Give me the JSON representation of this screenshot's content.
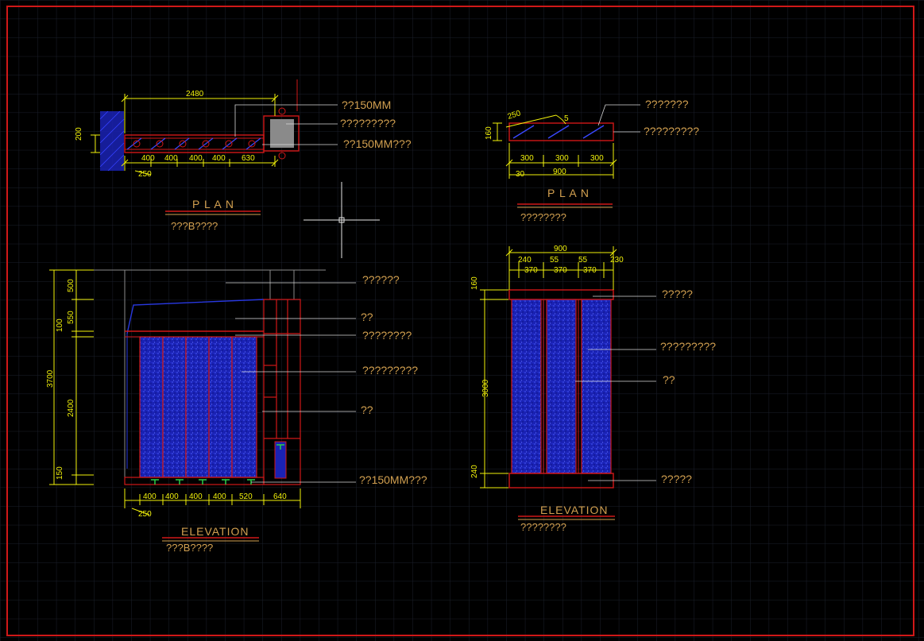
{
  "colors": {
    "background": "#000000",
    "grid": "#1e2330",
    "frame": "#d01818",
    "dimension": "#f2f20a",
    "annotation_text": "#d2a050",
    "title_text": "#d2a050",
    "wall": "#d01818",
    "panel_fill": "#1a22b4",
    "accent": "#2bd14a",
    "crosshair": "#e6e6e6"
  },
  "icons": {
    "crosshair": "crosshair-cursor-icon",
    "fixture": "lamp-fixture-icon"
  },
  "plan_left": {
    "dims": {
      "total_width": "2480",
      "height": "200",
      "seg1": "400",
      "seg2": "400",
      "seg3": "400",
      "seg4": "400",
      "seg5": "630",
      "offset": "250"
    },
    "notes": [
      "??150MM",
      "?????????",
      "??150MM???"
    ],
    "title": "P L A N",
    "subtitle": "???B????"
  },
  "plan_right": {
    "dims": {
      "angle": "250",
      "angle2": "5",
      "height": "160",
      "seg1": "300",
      "seg2": "300",
      "seg3": "300",
      "total": "900",
      "offset": "30"
    },
    "notes": [
      "???????",
      "?????????"
    ],
    "title": "P L A N",
    "subtitle": "????????"
  },
  "elev_left": {
    "dims": {
      "total": "3700",
      "top": "500",
      "band1": "550",
      "band2": "100",
      "mid": "2400",
      "bottom": "150",
      "b1": "400",
      "b2": "400",
      "b3": "400",
      "b4": "400",
      "b5": "520",
      "b6": "640",
      "offset": "250"
    },
    "notes": [
      "??????",
      "??",
      "????????",
      "?????????",
      "??",
      "??150MM???"
    ],
    "title": "ELEVATION",
    "subtitle": "???B????"
  },
  "elev_right": {
    "dims": {
      "total": "900",
      "t1": "240",
      "t2": "55",
      "t3": "55",
      "t4": "230",
      "w1": "370",
      "w2": "370",
      "w3": "370",
      "top": "160",
      "mid": "3000",
      "bottom": "240"
    },
    "notes": [
      "?????",
      "?????????",
      "??",
      "?????"
    ],
    "title": "ELEVATION",
    "subtitle": "????????"
  }
}
